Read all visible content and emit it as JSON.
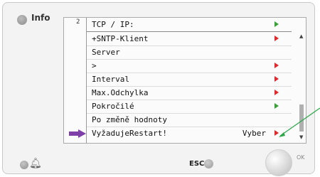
{
  "panel": {
    "info_label": "Info",
    "level": "2",
    "header": "TCP / IP:",
    "rows": [
      {
        "text": "+SNTP-Klient",
        "value": "",
        "marker": "red"
      },
      {
        "text": "Server",
        "value": "",
        "marker": ""
      },
      {
        "text": ">",
        "value": "",
        "marker": "red"
      },
      {
        "text": "Interval",
        "value": "",
        "marker": "red"
      },
      {
        "text": "Max.Odchylka",
        "value": "",
        "marker": "red"
      },
      {
        "text": "Pokročilé",
        "value": "",
        "marker": "green"
      },
      {
        "text": "Po změně hodnoty",
        "value": "",
        "marker": ""
      },
      {
        "text": "VyžadujeRestart!",
        "value": "Vyber",
        "marker": "red"
      }
    ],
    "esc_label": "ESC",
    "ok_label": "OK"
  },
  "colors": {
    "marker_red": "#e0282d",
    "marker_green": "#3aa03a",
    "pointer_arrow": "#7e3fa8",
    "callout_line": "#2ca84a"
  },
  "icons": [
    "bell-icon",
    "pointer-arrow-icon",
    "scroll-up-icon",
    "scroll-down-icon"
  ]
}
